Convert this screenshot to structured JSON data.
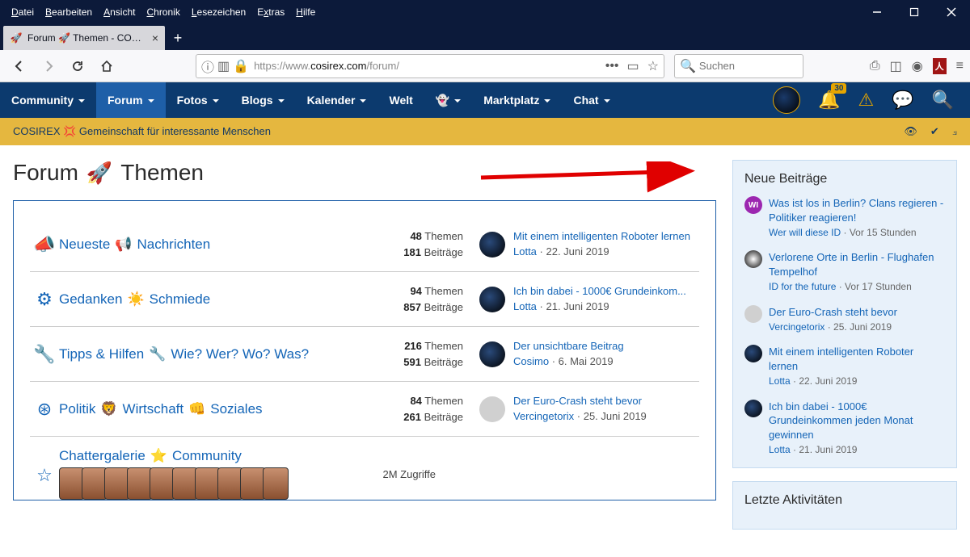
{
  "window": {
    "menu": [
      "Datei",
      "Bearbeiten",
      "Ansicht",
      "Chronik",
      "Lesezeichen",
      "Extras",
      "Hilfe"
    ],
    "tab_title": "Forum 🚀 Themen - COSIREX"
  },
  "toolbar": {
    "url_prefix": "https://www.",
    "url_domain": "cosirex.com",
    "url_suffix": "/forum/",
    "search_placeholder": "Suchen"
  },
  "nav": {
    "items": [
      {
        "label": "Community",
        "chev": true
      },
      {
        "label": "Forum",
        "chev": true,
        "active": true
      },
      {
        "label": "Fotos",
        "chev": true
      },
      {
        "label": "Blogs",
        "chev": true
      },
      {
        "label": "Kalender",
        "chev": true
      },
      {
        "label": "Welt",
        "chev": false
      },
      {
        "label": "👻",
        "chev": true
      },
      {
        "label": "Marktplatz",
        "chev": true
      },
      {
        "label": "Chat",
        "chev": true
      }
    ],
    "notif_count": "30"
  },
  "crumb": {
    "text": "COSIREX 💢 Gemeinschaft für interessante Menschen"
  },
  "page": {
    "title_pre": "Forum",
    "title_post": "Themen"
  },
  "forums": [
    {
      "title_parts": [
        "Neueste",
        "📢",
        "Nachrichten"
      ],
      "icon": "bullhorn",
      "themen": "48",
      "beitraege": "181",
      "last_title": "Mit einem intelligenten Roboter lernen",
      "last_author": "Lotta",
      "last_date": "22. Juni 2019",
      "ava": "dark"
    },
    {
      "title_parts": [
        "Gedanken",
        "☀️",
        "Schmiede"
      ],
      "icon": "gear",
      "themen": "94",
      "beitraege": "857",
      "last_title": "Ich bin dabei - 1000€ Grundeinkom...",
      "last_author": "Lotta",
      "last_date": "21. Juni 2019",
      "ava": "dark"
    },
    {
      "title_parts": [
        "Tipps & Hilfen",
        "🔧",
        "Wie? Wer? Wo? Was?"
      ],
      "icon": "wrench",
      "themen": "216",
      "beitraege": "591",
      "last_title": "Der unsichtbare Beitrag",
      "last_author": "Cosimo",
      "last_date": "6. Mai 2019",
      "ava": "dark"
    },
    {
      "title_parts": [
        "Politik",
        "🦁",
        "Wirtschaft",
        "👊",
        "Soziales"
      ],
      "icon": "empire",
      "themen": "84",
      "beitraege": "261",
      "last_title": "Der Euro-Crash steht bevor",
      "last_author": "Vercingetorix",
      "last_date": "25. Juni 2019",
      "ava": "light"
    }
  ],
  "gallery": {
    "title_parts": [
      "Chattergalerie",
      "⭐",
      "Community"
    ],
    "zugriffe": "2M",
    "zugriffe_label": "Zugriffe"
  },
  "labels": {
    "themen": "Themen",
    "beitraege": "Beiträge"
  },
  "sidebar": {
    "neue_title": "Neue Beiträge",
    "letzte_title": "Letzte Aktivitäten",
    "posts": [
      {
        "title": "Was ist los in Berlin? Clans regieren - Politiker reagieren!",
        "author": "Wer will diese ID",
        "date": "Vor 15 Stunden",
        "ava": "wi",
        "ava_txt": "WI"
      },
      {
        "title": "Verlorene Orte in Berlin - Flughafen Tempelhof",
        "author": "ID for the future",
        "date": "Vor 17 Stunden",
        "ava": "bw"
      },
      {
        "title": "Der Euro-Crash steht bevor",
        "author": "Vercingetorix",
        "date": "25. Juni 2019",
        "ava": "lt"
      },
      {
        "title": "Mit einem intelligenten Roboter lernen",
        "author": "Lotta",
        "date": "22. Juni 2019",
        "ava": "dark"
      },
      {
        "title": "Ich bin dabei - 1000€ Grundeinkommen jeden Monat gewinnen",
        "author": "Lotta",
        "date": "21. Juni 2019",
        "ava": "dark"
      }
    ]
  }
}
